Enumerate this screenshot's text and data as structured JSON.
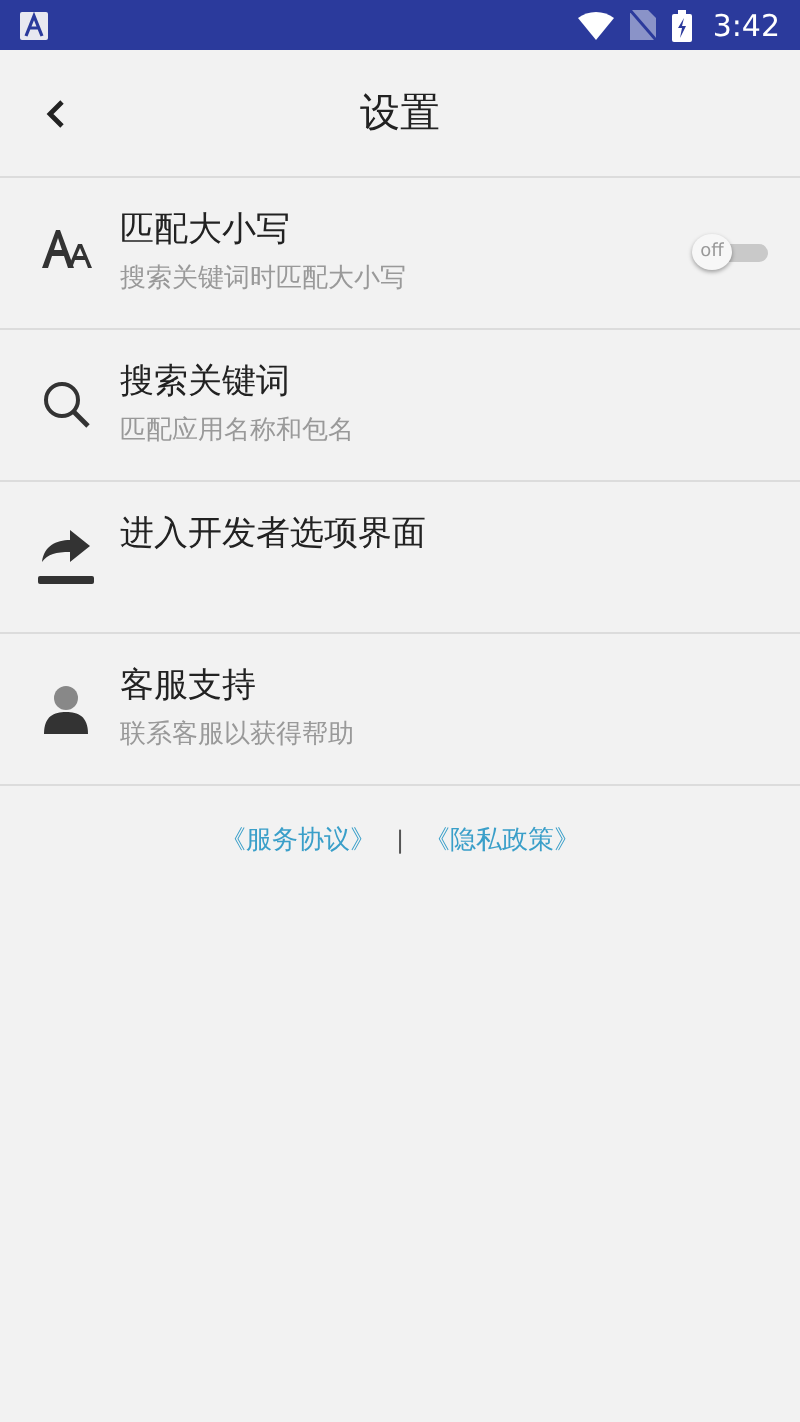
{
  "status_bar": {
    "time": "3:42"
  },
  "header": {
    "title": "设置"
  },
  "items": [
    {
      "kind": "toggle",
      "title": "匹配大小写",
      "subtitle": "搜索关键词时匹配大小写",
      "toggle": {
        "on": false,
        "label": "off"
      }
    },
    {
      "kind": "plain",
      "title": "搜索关键词",
      "subtitle": "匹配应用名称和包名"
    },
    {
      "kind": "plain",
      "title": "进入开发者选项界面"
    },
    {
      "kind": "plain",
      "title": "客服支持",
      "subtitle": "联系客服以获得帮助"
    }
  ],
  "footer": {
    "links": [
      "《服务协议》",
      "《隐私政策》"
    ],
    "separator": "|"
  }
}
